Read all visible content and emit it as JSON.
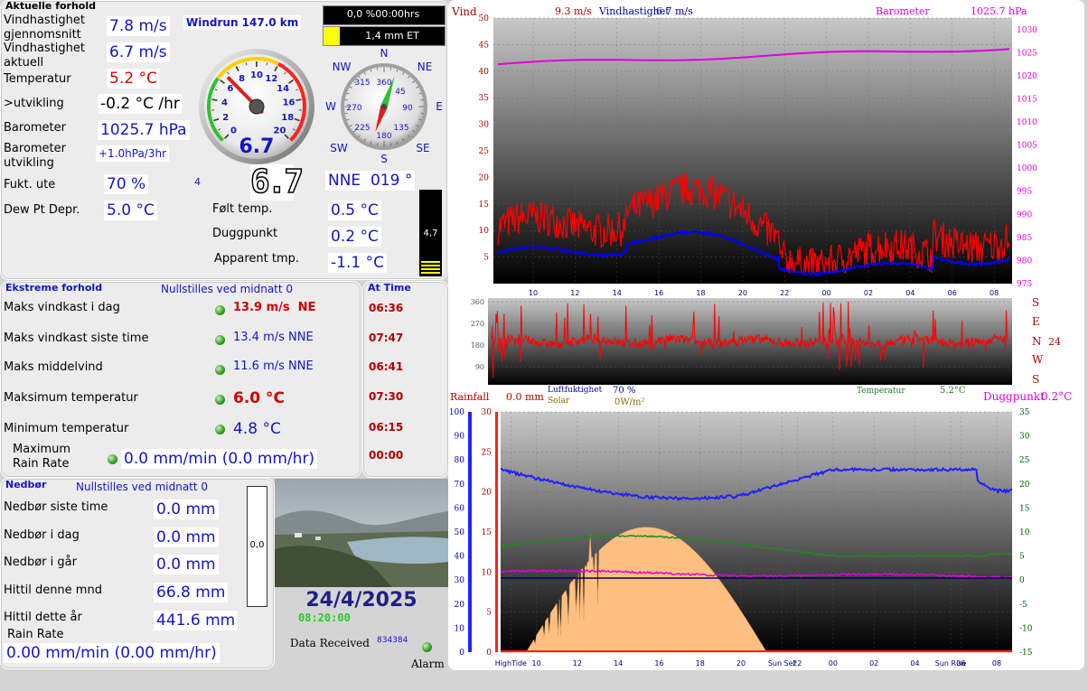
{
  "current": {
    "title": "Aktuelle forhold",
    "avg_wind_label": "Vindhastighet gjennomsnitt",
    "avg_wind": "7.8 m/s",
    "cur_wind_label": "Vindhastighet aktuell",
    "cur_wind": "6.7 m/s",
    "temp_label": "Temperatur",
    "temp": "5.2 °C",
    "trend_label": ">utvikling",
    "trend": "-0.2 °C /hr",
    "baro_label": "Barometer",
    "baro": "1025.7 hPa",
    "baro_trend_label": "Barometer utvikling",
    "baro_trend": "+1.0hPa/3hr",
    "hum_label": "Fukt. ute",
    "hum": "70 %",
    "dew_label": "Dew Pt Depr.",
    "dew": "5.0 °C",
    "windrun": "Windrun 147.0 km",
    "et_top": "0,0 %00:00hrs",
    "et_bottom": "1,4 mm ET",
    "gauge_value": "6.7",
    "gauge_ticks": [
      "0",
      "2",
      "4",
      "6",
      "8",
      "10",
      "12",
      "14",
      "16",
      "18",
      "20"
    ],
    "gauge_level": 6.7,
    "gauge_max": 20,
    "digital": "6.7",
    "digital_small": "4",
    "compass_labels": {
      "n": "N",
      "ne": "NE",
      "e": "E",
      "se": "SE",
      "s": "S",
      "sw": "SW",
      "w": "W",
      "nw": "NW"
    },
    "compass_degrees": [
      "360",
      "45",
      "90",
      "135",
      "180",
      "225",
      "270",
      "315"
    ],
    "direction": "NNE  019 °",
    "bearing": 19,
    "felt_label": "Følt temp.",
    "felt": "0.5 °C",
    "dugg_label": "Duggpunkt",
    "dugg": "0.2 °C",
    "apparent_label": "Apparent tmp.",
    "apparent": "-1.1 °C",
    "bar_value": "4,7"
  },
  "extremes": {
    "title": "Ekstreme forhold",
    "reset_note": "Nullstilles ved midnatt 0",
    "at_time_title": "At Time",
    "rows": [
      {
        "label": "Maks vindkast i dag",
        "value": "13.9 m/s  NE",
        "time": "06:36"
      },
      {
        "label": "Maks vindkast siste time",
        "value": "13.4 m/s NNE",
        "time": "07:47"
      },
      {
        "label": "Maks middelvind",
        "value": "11.6 m/s NNE",
        "time": "06:41"
      },
      {
        "label": "Maksimum temperatur",
        "value": "6.0 °C",
        "time": "07:30"
      },
      {
        "label": "Minimum temperatur",
        "value": "4.8 °C",
        "time": "06:15"
      }
    ],
    "rain_rate_label": "Maximum Rain Rate",
    "rain_rate": "0.0 mm/min (0.0 mm/hr)",
    "rain_rate_time": "00:00"
  },
  "rain": {
    "title": "Nedbør",
    "reset_note": "Nullstilles ved midnatt 0",
    "rows": [
      {
        "label": "Nedbør siste time",
        "value": "0.0 mm"
      },
      {
        "label": "Nedbør i dag",
        "value": "0.0 mm"
      },
      {
        "label": "Nedbør i går",
        "value": "0.0 mm"
      },
      {
        "label": "Hittil denne mnd",
        "value": "66.8 mm"
      },
      {
        "label": "Hittil dette år",
        "value": "441.6 mm"
      }
    ],
    "rate_label": "Rain Rate",
    "rate": "0.00 mm/min (0.00 mm/hr)",
    "gauge_value": "0,0",
    "date": "24/4/2025",
    "time": "08:20:00",
    "data_received_label": "Data Received",
    "data_received": "834384",
    "alarm_label": "Alarm"
  },
  "charts": {
    "wind": {
      "label": "Vind",
      "gust_text": "9.3 m/s",
      "speed_text": "Vindhastighet",
      "speed_value": "6.7 m/s",
      "baro_label": "Barometer",
      "baro_value": "1025.7 hPa",
      "left_ticks": [
        "50",
        "45",
        "40",
        "35",
        "30",
        "25",
        "20",
        "15",
        "10",
        "5"
      ],
      "right_ticks": [
        "1030",
        "1025",
        "1020",
        "1015",
        "1010",
        "1005",
        "1000",
        "995",
        "990",
        "985",
        "980",
        "975"
      ],
      "x_ticks": [
        "10",
        "12",
        "14",
        "16",
        "18",
        "20",
        "22",
        "00",
        "02",
        "04",
        "06",
        "08"
      ]
    },
    "direction": {
      "left_ticks": [
        "360",
        "270",
        "180",
        "90"
      ],
      "right_labels": [
        "S",
        "E",
        "N",
        "W",
        "S"
      ],
      "right_value": "24"
    },
    "lower": {
      "rainfall_label": "Rainfall",
      "rainfall_value": "0.0 mm",
      "hum_label": "Luftfuktighet",
      "hum_value": "70 %",
      "solar_label": "Solar",
      "solar_value": "0W/m²",
      "temp_label": "Temperatur",
      "temp_value": "5.2°C",
      "dew_label": "Duggpunkt",
      "dew_value": "0.2°C",
      "left1_ticks": [
        "100",
        "90",
        "80",
        "70",
        "60",
        "50",
        "40",
        "30",
        "20",
        "10",
        "0"
      ],
      "left2_ticks": [
        "30",
        "25",
        "20",
        "15",
        "10",
        "5",
        "0"
      ],
      "right_ticks": [
        "35",
        "30",
        "25",
        "20",
        "15",
        "10",
        "5",
        "0",
        "-5",
        "-10",
        "-15"
      ],
      "x_ticks": [
        "HighTide",
        "10",
        "12",
        "14",
        "16",
        "18",
        "20",
        "Sun Set",
        "22",
        "00",
        "02",
        "04",
        "Sun Rise",
        "06",
        "08"
      ]
    }
  },
  "colors": {
    "value_blue": "#1414c8",
    "value_red": "#e00000",
    "wind_red": "#ff0000",
    "wind_blue": "#0000ff",
    "baro_magenta": "#e000e0",
    "temp_green": "#1f8a1f",
    "solar_fill": "#ffbf80"
  }
}
